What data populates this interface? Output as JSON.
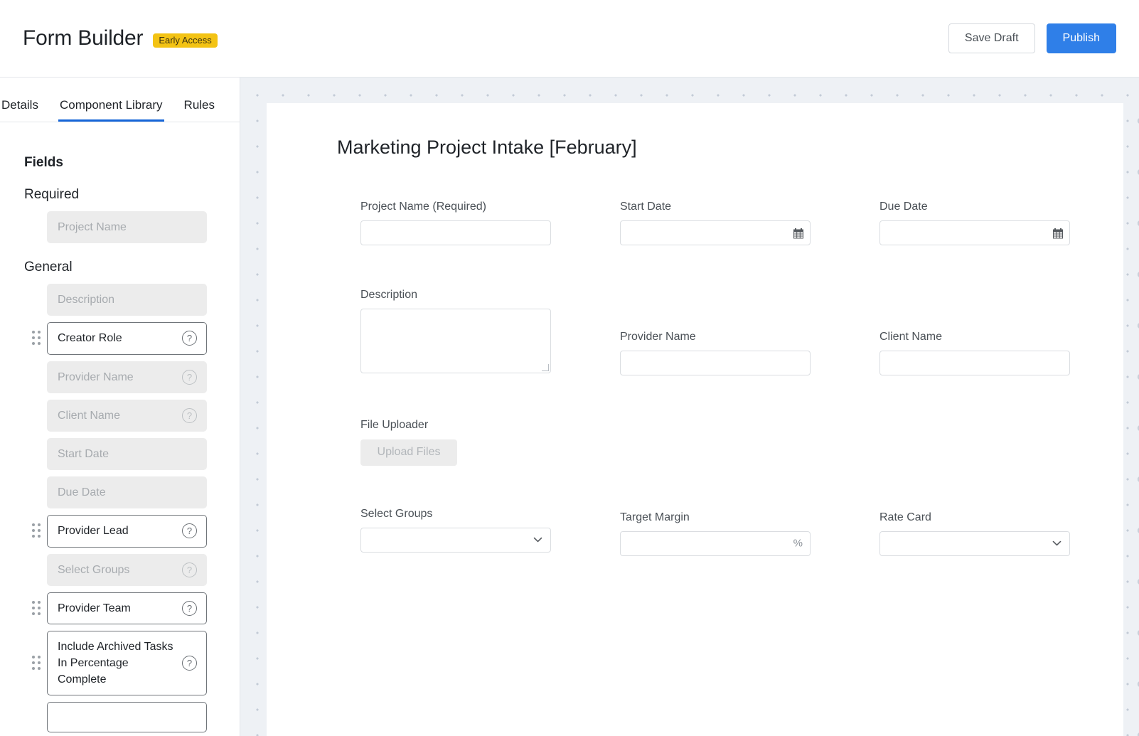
{
  "header": {
    "title": "Form Builder",
    "badge": "Early Access",
    "save_draft_label": "Save Draft",
    "publish_label": "Publish"
  },
  "sidebar": {
    "tabs": [
      {
        "label": "Details",
        "active": false
      },
      {
        "label": "Component Library",
        "active": true
      },
      {
        "label": "Rules",
        "active": false
      }
    ],
    "section_title": "Fields",
    "groups": [
      {
        "label": "Required",
        "fields": [
          {
            "label": "Project Name",
            "state": "used",
            "has_help": false,
            "has_grip": false
          }
        ]
      },
      {
        "label": "General",
        "fields": [
          {
            "label": "Description",
            "state": "used",
            "has_help": false,
            "has_grip": false
          },
          {
            "label": "Creator Role",
            "state": "available",
            "has_help": true,
            "has_grip": true
          },
          {
            "label": "Provider Name",
            "state": "used",
            "has_help": true,
            "has_grip": false
          },
          {
            "label": "Client Name",
            "state": "used",
            "has_help": true,
            "has_grip": false
          },
          {
            "label": "Start Date",
            "state": "used",
            "has_help": false,
            "has_grip": false
          },
          {
            "label": "Due Date",
            "state": "used",
            "has_help": false,
            "has_grip": false
          },
          {
            "label": "Provider Lead",
            "state": "available",
            "has_help": true,
            "has_grip": true
          },
          {
            "label": "Select Groups",
            "state": "used",
            "has_help": true,
            "has_grip": false
          },
          {
            "label": "Provider Team",
            "state": "available",
            "has_help": true,
            "has_grip": true
          },
          {
            "label": "Include Archived Tasks In Percentage Complete",
            "state": "available",
            "has_help": true,
            "has_grip": true
          },
          {
            "label": "",
            "state": "available",
            "has_help": false,
            "has_grip": false
          }
        ]
      }
    ],
    "icons": {
      "grip": "drag-handle-icon",
      "help": "help-circle-icon"
    }
  },
  "canvas": {
    "form_title": "Marketing Project Intake [February]",
    "rows": [
      {
        "cells": [
          {
            "label": "Project Name (Required)",
            "control": "text"
          },
          {
            "label": "Start Date",
            "control": "date"
          },
          {
            "label": "Due Date",
            "control": "date"
          }
        ]
      },
      {
        "cells": [
          {
            "label": "Description",
            "control": "textarea"
          },
          {
            "label": "Provider Name",
            "control": "text"
          },
          {
            "label": "Client Name",
            "control": "text"
          }
        ]
      },
      {
        "cells": [
          {
            "label": "File Uploader",
            "control": "upload",
            "button_label": "Upload Files"
          },
          {
            "label": "",
            "control": "none"
          },
          {
            "label": "",
            "control": "none"
          }
        ]
      },
      {
        "cells": [
          {
            "label": "Select Groups",
            "control": "select"
          },
          {
            "label": "Target Margin",
            "control": "percent",
            "suffix": "%"
          },
          {
            "label": "Rate Card",
            "control": "select"
          }
        ]
      }
    ]
  },
  "colors": {
    "accent_blue": "#2f7fe8",
    "tab_underline": "#1565d8",
    "badge_amber": "#f3c314",
    "canvas_bg": "#eef1f5",
    "used_chip_bg": "#ececec"
  }
}
